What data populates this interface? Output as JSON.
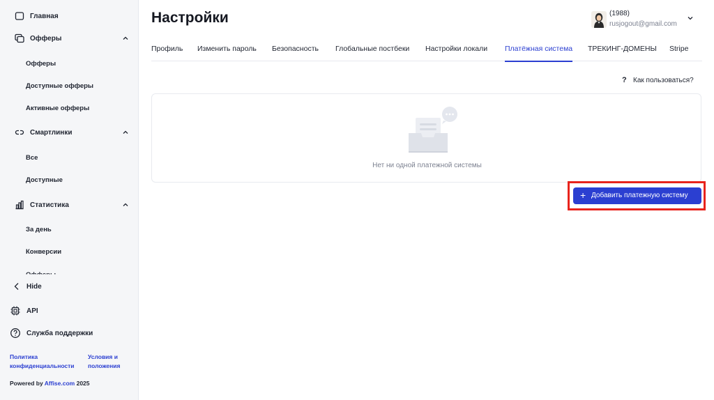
{
  "sidebar": {
    "items": [
      {
        "label": "Главная",
        "icon": "home-square-icon"
      },
      {
        "label": "Офферы",
        "icon": "offers-copy-icon",
        "expanded": true
      },
      {
        "label": "Смартлинки",
        "icon": "link-icon",
        "expanded": true
      },
      {
        "label": "Статистика",
        "icon": "bar-chart-icon",
        "expanded": true
      }
    ],
    "offers_sub": [
      "Офферы",
      "Доступные офферы",
      "Активные офферы"
    ],
    "smartlinks_sub": [
      "Все",
      "Доступные"
    ],
    "stats_sub": [
      "За день",
      "Конверсии",
      "Офферы"
    ],
    "hide_label": "Hide",
    "api_label": "API",
    "support_label": "Служба поддержки",
    "privacy_line1": "Политика",
    "privacy_line2": "конфиденциальности",
    "terms_line1": "Условия и",
    "terms_line2": "положения",
    "powered_prefix": "Powered by ",
    "powered_link": "Affise.com",
    "powered_year": " 2025"
  },
  "header": {
    "title": "Настройки",
    "user_name": "(1988)",
    "user_email": "rusjogout@gmail.com"
  },
  "tabs": [
    {
      "label": "Профиль",
      "active": false
    },
    {
      "label": "Изменить пароль",
      "active": false
    },
    {
      "label": "Безопасность",
      "active": false
    },
    {
      "label": "Глобальные постбеки",
      "active": false
    },
    {
      "label": "Настройки локали",
      "active": false
    },
    {
      "label": "Платёжная система",
      "active": true
    },
    {
      "label": "ТРЕКИНГ-ДОМЕНЫ",
      "active": false
    },
    {
      "label": "Stripe",
      "active": false
    }
  ],
  "help": {
    "q": "?",
    "label": "Как пользоваться?"
  },
  "empty_state": {
    "text": "Нет ни одной платежной системы"
  },
  "add_button": {
    "plus": "+",
    "label": "Добавить платежную систему"
  },
  "colors": {
    "accent": "#2b3fd1",
    "highlight": "#e8231c",
    "sidebar_bg": "#f5f6f8"
  }
}
